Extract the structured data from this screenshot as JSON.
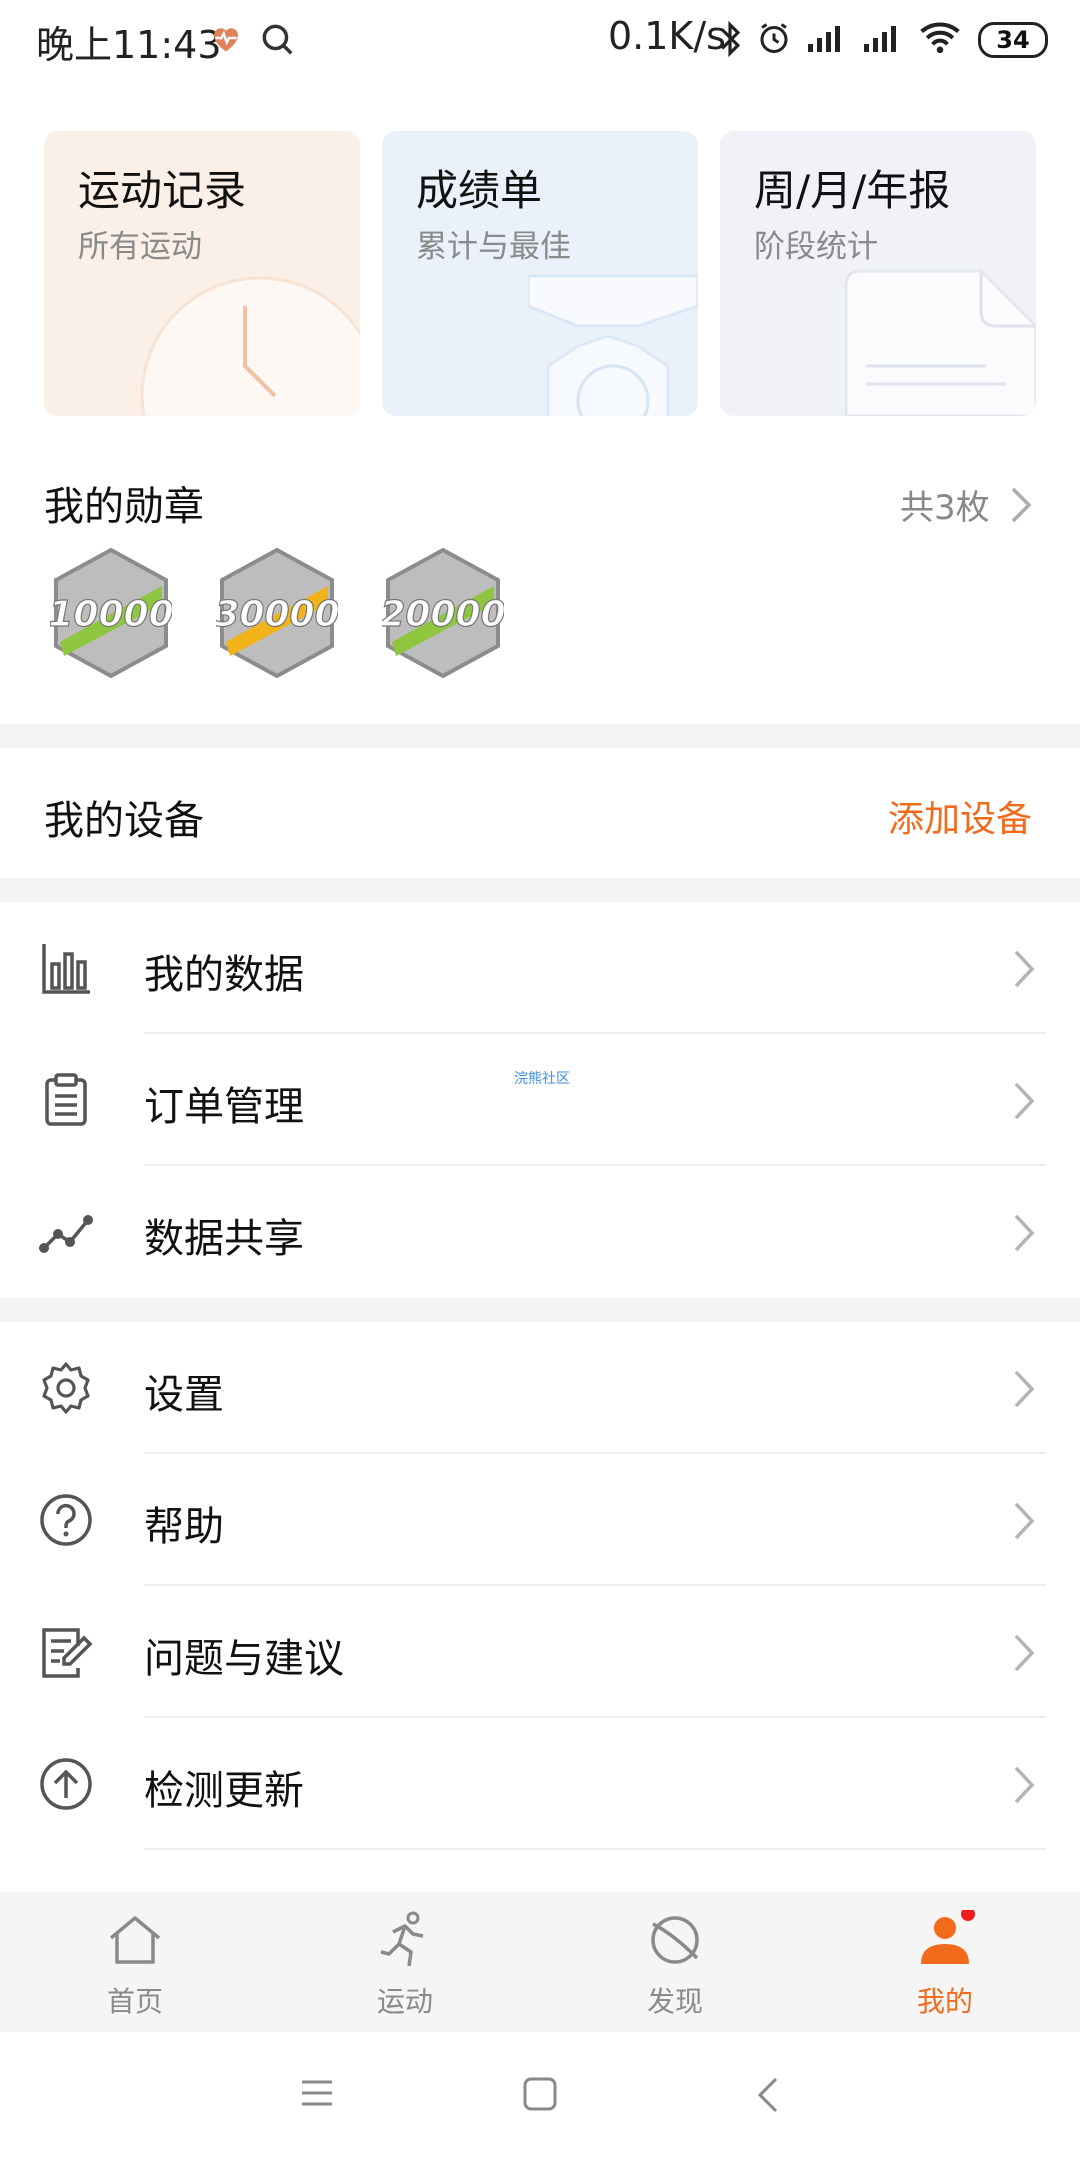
{
  "status_bar": {
    "time": "晚上11:43",
    "network_speed": "0.1K/s",
    "battery": "34",
    "icons": [
      "heart-rate-icon",
      "search-icon",
      "bluetooth-icon",
      "alarm-icon",
      "signal-icon",
      "signal-icon",
      "wifi-icon",
      "battery-icon"
    ]
  },
  "cards": [
    {
      "title": "运动记录",
      "subtitle": "所有运动",
      "color": "#fbf0e7",
      "icon": "clock-icon"
    },
    {
      "title": "成绩单",
      "subtitle": "累计与最佳",
      "color": "#eaf1fb",
      "icon": "trophy-icon"
    },
    {
      "title": "周/月/年报",
      "subtitle": "阶段统计",
      "color": "#f1f2f7",
      "icon": "report-icon"
    }
  ],
  "medals": {
    "title": "我的勋章",
    "count": "共3枚",
    "items": [
      {
        "value": "10000",
        "accent": "#8ec63f"
      },
      {
        "value": "30000",
        "accent": "#f2b21a"
      },
      {
        "value": "20000",
        "accent": "#8ec63f"
      }
    ]
  },
  "devices": {
    "title": "我的设备",
    "add_label": "添加设备",
    "accent": "#f26b1d"
  },
  "watermark": "浣熊社区",
  "menu_group1": [
    {
      "label": "我的数据",
      "icon": "bar-chart-icon"
    },
    {
      "label": "订单管理",
      "icon": "clipboard-icon"
    },
    {
      "label": "数据共享",
      "icon": "share-graph-icon"
    }
  ],
  "menu_group2": [
    {
      "label": "设置",
      "icon": "gear-icon"
    },
    {
      "label": "帮助",
      "icon": "help-icon"
    },
    {
      "label": "问题与建议",
      "icon": "feedback-icon"
    },
    {
      "label": "检测更新",
      "icon": "update-icon"
    }
  ],
  "tabs": [
    {
      "label": "首页",
      "icon": "home-icon",
      "active": false
    },
    {
      "label": "运动",
      "icon": "run-icon",
      "active": false
    },
    {
      "label": "发现",
      "icon": "discover-icon",
      "active": false
    },
    {
      "label": "我的",
      "icon": "profile-icon",
      "active": true
    }
  ],
  "system_nav": [
    "menu-icon",
    "home-square-icon",
    "back-icon"
  ]
}
